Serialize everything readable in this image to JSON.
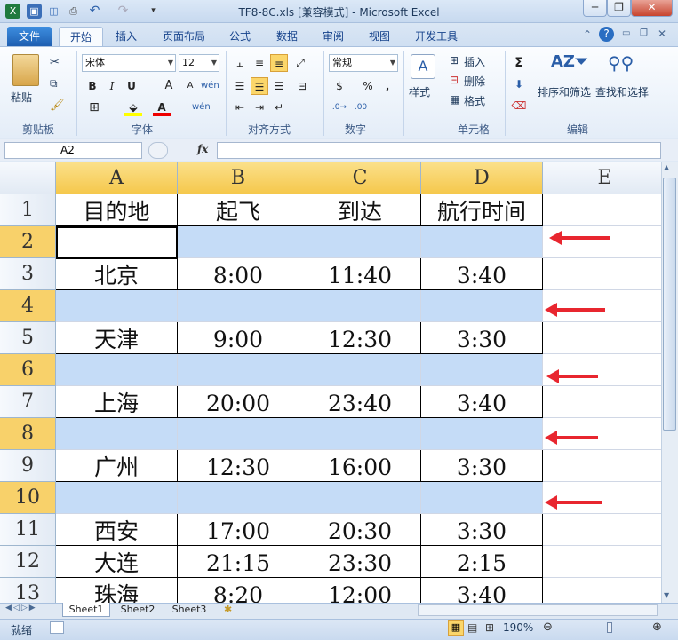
{
  "window": {
    "title": "TF8-8C.xls  [兼容模式] - Microsoft Excel",
    "minimize": "─",
    "restore": "❐",
    "close": "✕"
  },
  "tabs": [
    "文件",
    "开始",
    "插入",
    "页面布局",
    "公式",
    "数据",
    "审阅",
    "视图",
    "开发工具"
  ],
  "ribbon": {
    "clipboard": {
      "paste": "粘贴",
      "group": "剪贴板"
    },
    "font": {
      "name": "宋体",
      "size": "12",
      "group": "字体",
      "bold": "B",
      "italic": "I",
      "underline": "U",
      "grow": "A",
      "shrink": "A"
    },
    "alignment": {
      "group": "对齐方式"
    },
    "number": {
      "format": "常规",
      "group": "数字",
      "currency": "$",
      "percent": "%",
      "comma": ","
    },
    "styles": {
      "label": "样式"
    },
    "cells": {
      "insert": "插入",
      "delete": "删除",
      "format": "格式",
      "group": "单元格"
    },
    "editing": {
      "sum": "Σ",
      "sort_filter": "排序和筛选",
      "find_select": "查找和选择",
      "group": "编辑"
    }
  },
  "formula_bar": {
    "name_box": "A2",
    "fx": "fx",
    "formula": ""
  },
  "columns": [
    "A",
    "B",
    "C",
    "D",
    "E"
  ],
  "rows": [
    {
      "n": "1",
      "cells": [
        "目的地",
        "起飞",
        "到达",
        "航行时间"
      ],
      "blank": false,
      "header": true
    },
    {
      "n": "2",
      "cells": [
        "",
        "",
        "",
        ""
      ],
      "blank": true
    },
    {
      "n": "3",
      "cells": [
        "北京",
        "8:00",
        "11:40",
        "3:40"
      ],
      "blank": false
    },
    {
      "n": "4",
      "cells": [
        "",
        "",
        "",
        ""
      ],
      "blank": true
    },
    {
      "n": "5",
      "cells": [
        "天津",
        "9:00",
        "12:30",
        "3:30"
      ],
      "blank": false
    },
    {
      "n": "6",
      "cells": [
        "",
        "",
        "",
        ""
      ],
      "blank": true
    },
    {
      "n": "7",
      "cells": [
        "上海",
        "20:00",
        "23:40",
        "3:40"
      ],
      "blank": false
    },
    {
      "n": "8",
      "cells": [
        "",
        "",
        "",
        ""
      ],
      "blank": true
    },
    {
      "n": "9",
      "cells": [
        "广州",
        "12:30",
        "16:00",
        "3:30"
      ],
      "blank": false
    },
    {
      "n": "10",
      "cells": [
        "",
        "",
        "",
        ""
      ],
      "blank": true
    },
    {
      "n": "11",
      "cells": [
        "西安",
        "17:00",
        "20:30",
        "3:30"
      ],
      "blank": false
    },
    {
      "n": "12",
      "cells": [
        "大连",
        "21:15",
        "23:30",
        "2:15"
      ],
      "blank": false
    },
    {
      "n": "13",
      "cells": [
        "珠海",
        "8:20",
        "12:00",
        "3:40"
      ],
      "blank": false
    }
  ],
  "sheets": [
    "Sheet1",
    "Sheet2",
    "Sheet3"
  ],
  "status": {
    "ready": "就绪",
    "zoom": "190%"
  },
  "colors": {
    "blank_row_fill": "#c5dcf7",
    "arrow": "#e8262f",
    "selected_header": "#f8d16a"
  }
}
